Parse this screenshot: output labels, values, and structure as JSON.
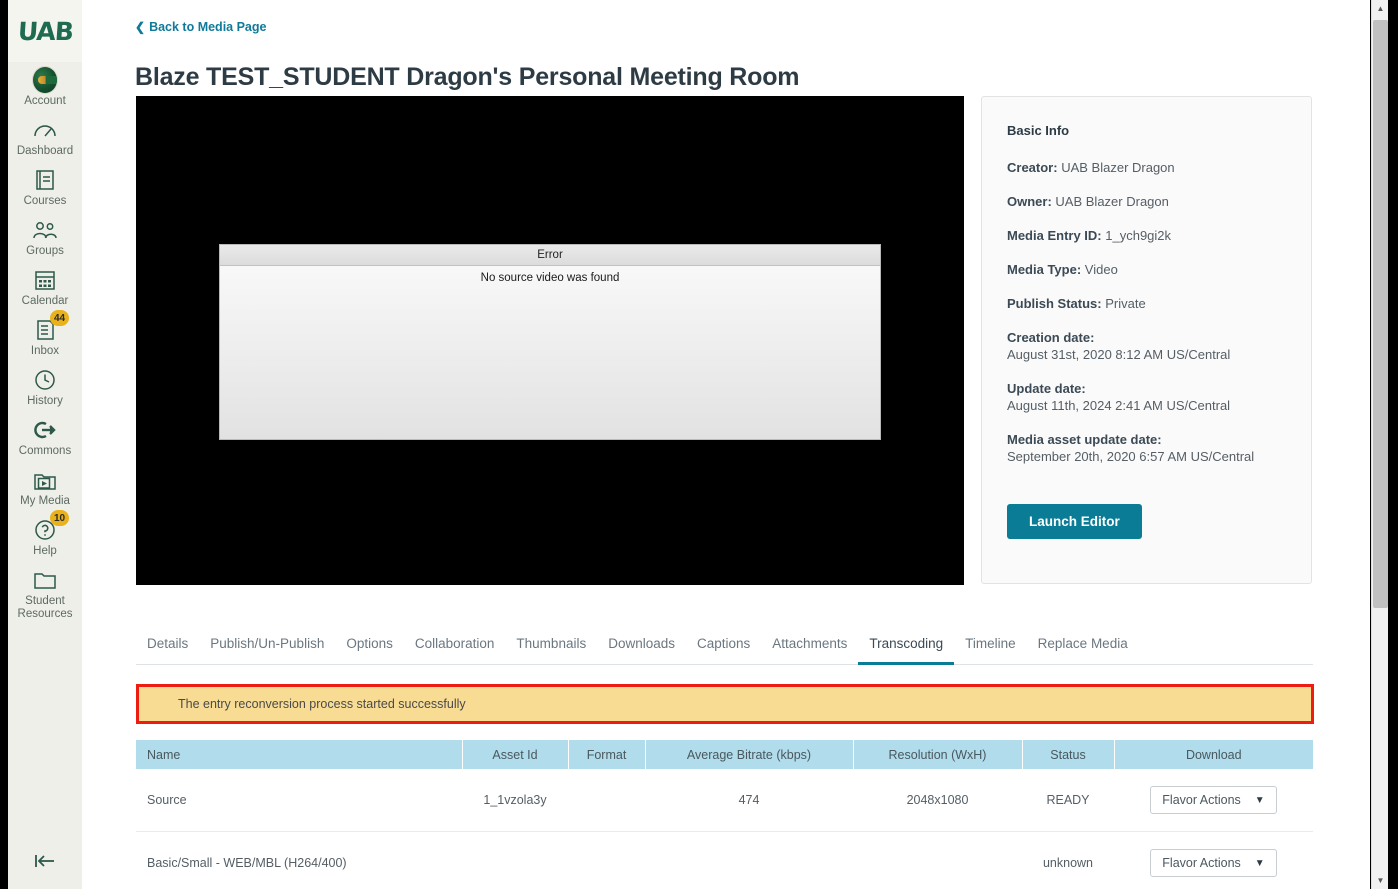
{
  "sidebar": {
    "logo_text": "UAB",
    "items": [
      {
        "label": "Account",
        "icon": "avatar-icon",
        "badge": null
      },
      {
        "label": "Dashboard",
        "icon": "gauge-icon",
        "badge": null
      },
      {
        "label": "Courses",
        "icon": "book-icon",
        "badge": null
      },
      {
        "label": "Groups",
        "icon": "people-icon",
        "badge": null
      },
      {
        "label": "Calendar",
        "icon": "calendar-icon",
        "badge": null
      },
      {
        "label": "Inbox",
        "icon": "inbox-icon",
        "badge": "44"
      },
      {
        "label": "History",
        "icon": "clock-icon",
        "badge": null
      },
      {
        "label": "Commons",
        "icon": "commons-icon",
        "badge": null
      },
      {
        "label": "My Media",
        "icon": "video-folder-icon",
        "badge": null
      },
      {
        "label": "Help",
        "icon": "help-icon",
        "badge": "10"
      },
      {
        "label": "Student Resources",
        "icon": "folder-icon",
        "badge": null
      }
    ],
    "collapse_icon": "collapse-left-icon"
  },
  "header": {
    "back_link": "Back to Media Page",
    "back_chevron": "chevron-left-icon",
    "title": "Blaze TEST_STUDENT Dragon's Personal Meeting Room"
  },
  "player": {
    "error_title": "Error",
    "error_message": "No source video was found"
  },
  "info": {
    "heading": "Basic Info",
    "rows": [
      {
        "key": "Creator:",
        "value": "UAB Blazer Dragon",
        "stacked": false
      },
      {
        "key": "Owner:",
        "value": "UAB Blazer Dragon",
        "stacked": false
      },
      {
        "key": "Media Entry ID:",
        "value": "1_ych9gi2k",
        "stacked": false
      },
      {
        "key": "Media Type:",
        "value": "Video",
        "stacked": false
      },
      {
        "key": "Publish Status:",
        "value": "Private",
        "stacked": false
      },
      {
        "key": "Creation date:",
        "value": "August 31st, 2020 8:12 AM US/Central",
        "stacked": true
      },
      {
        "key": "Update date:",
        "value": "August 11th, 2024 2:41 AM US/Central",
        "stacked": true
      },
      {
        "key": "Media asset update date:",
        "value": "September 20th, 2020 6:57 AM US/Central",
        "stacked": true
      }
    ],
    "launch_editor_label": "Launch Editor"
  },
  "tabs": {
    "items": [
      {
        "label": "Details",
        "active": false
      },
      {
        "label": "Publish/Un-Publish",
        "active": false
      },
      {
        "label": "Options",
        "active": false
      },
      {
        "label": "Collaboration",
        "active": false
      },
      {
        "label": "Thumbnails",
        "active": false
      },
      {
        "label": "Downloads",
        "active": false
      },
      {
        "label": "Captions",
        "active": false
      },
      {
        "label": "Attachments",
        "active": false
      },
      {
        "label": "Transcoding",
        "active": true
      },
      {
        "label": "Timeline",
        "active": false
      },
      {
        "label": "Replace Media",
        "active": false
      }
    ]
  },
  "alert": {
    "message": "The entry reconversion process started successfully",
    "background_color": "#f8dc94",
    "border_color": "#ee1d11"
  },
  "table": {
    "columns": [
      "Name",
      "Asset Id",
      "Format",
      "Average Bitrate (kbps)",
      "Resolution (WxH)",
      "Status",
      "Download"
    ],
    "header_background": "#b0dceb",
    "rows": [
      {
        "name": "Source",
        "asset_id": "1_1vzola3y",
        "format": "",
        "bitrate": "474",
        "resolution": "2048x1080",
        "status": "READY",
        "action_label": "Flavor Actions"
      },
      {
        "name": "Basic/Small - WEB/MBL (H264/400)",
        "asset_id": "",
        "format": "",
        "bitrate": "",
        "resolution": "",
        "status": "unknown",
        "action_label": "Flavor Actions"
      }
    ]
  },
  "scrollbar": {
    "up_arrow": "scroll-up-icon",
    "down_arrow": "scroll-down-icon"
  }
}
